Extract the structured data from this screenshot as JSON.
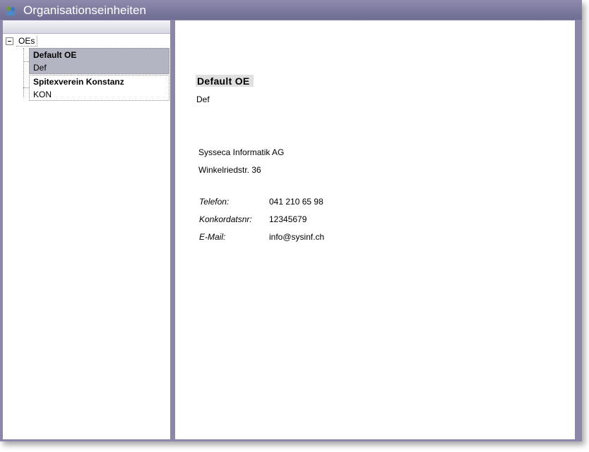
{
  "window": {
    "title": "Organisationseinheiten"
  },
  "tree": {
    "root": "OEs",
    "items": [
      {
        "name": "Default OE",
        "code": "Def",
        "selected": true
      },
      {
        "name": "Spitexverein Konstanz",
        "code": "KON",
        "selected": false
      }
    ]
  },
  "detail": {
    "name": "Default OE",
    "code": "Def",
    "company": "Sysseca Informatik AG",
    "street": "Winkelriedstr. 36",
    "fields": [
      {
        "label": "Telefon:",
        "value": "041 210 65 98"
      },
      {
        "label": "Konkordatsnr:",
        "value": "12345679"
      },
      {
        "label": "E-Mail:",
        "value": "info@sysinf.ch"
      }
    ]
  }
}
